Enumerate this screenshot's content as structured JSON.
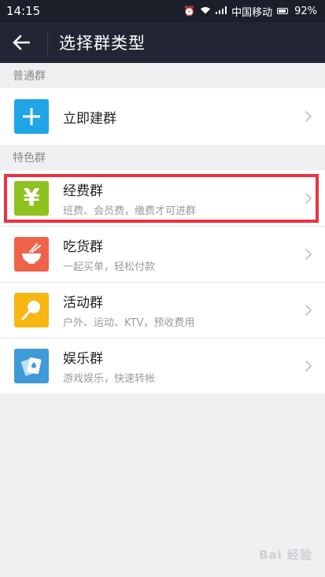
{
  "status_bar": {
    "time": "14:15",
    "carrier": "中国移动",
    "battery": "92%"
  },
  "app_bar": {
    "title": "选择群类型"
  },
  "sections": [
    {
      "header": "普通群",
      "items": [
        {
          "title": "立即建群",
          "subtitle": "",
          "icon": "plus-icon",
          "color": "#1fa5e8"
        }
      ]
    },
    {
      "header": "特色群",
      "items": [
        {
          "title": "经费群",
          "subtitle": "班费、会员费，缴费才可进群",
          "icon": "yen-icon",
          "color": "#8dc21f"
        },
        {
          "title": "吃货群",
          "subtitle": "一起买单，轻松付款",
          "icon": "bowl-icon",
          "color": "#f0634b"
        },
        {
          "title": "活动群",
          "subtitle": "户外、运动、KTV，预收费用",
          "icon": "balloon-icon",
          "color": "#f8b613"
        },
        {
          "title": "娱乐群",
          "subtitle": "游戏娱乐，快速转帐",
          "icon": "cards-icon",
          "color": "#3f9ad8"
        }
      ]
    }
  ],
  "highlight_color": "#f03040",
  "watermark": "Bai 经验"
}
